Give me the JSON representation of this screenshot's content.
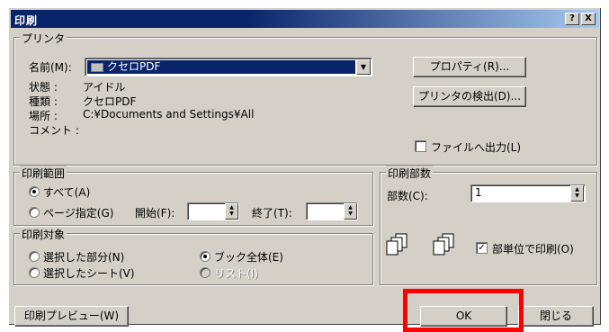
{
  "window": {
    "title": "印刷",
    "help_button": "?",
    "close_button": "X"
  },
  "printer": {
    "group_label": "プリンタ",
    "name_label": "名前(M):",
    "name_value": "クセロPDF",
    "status_label": "状態 :",
    "status_value": "アイドル",
    "type_label": "種類 :",
    "type_value": "クセロPDF",
    "location_label": "場所 :",
    "location_value": "C:¥Documents and Settings¥All",
    "comment_label": "コメント :",
    "properties_button": "プロパティ(R)...",
    "find_printer_button": "プリンタの検出(D)...",
    "print_to_file_label": "ファイルへ出力(L)",
    "print_to_file_checked": false
  },
  "range": {
    "group_label": "印刷範囲",
    "all_label": "すべて(A)",
    "pages_label": "ページ指定(G)",
    "from_label": "開始(F):",
    "to_label": "終了(T):",
    "from_value": "",
    "to_value": ""
  },
  "target": {
    "group_label": "印刷対象",
    "selection_label": "選択した部分(N)",
    "selected_sheets_label": "選択したシート(V)",
    "entire_book_label": "ブック全体(E)",
    "list_label": "リスト(I)"
  },
  "copies": {
    "group_label": "印刷部数",
    "count_label": "部数(C):",
    "count_value": "1",
    "collate_label": "部単位で印刷(O)",
    "collate_checked": true
  },
  "footer": {
    "preview_button": "印刷プレビュー(W)",
    "ok_button": "OK",
    "close_button": "閉じる"
  }
}
